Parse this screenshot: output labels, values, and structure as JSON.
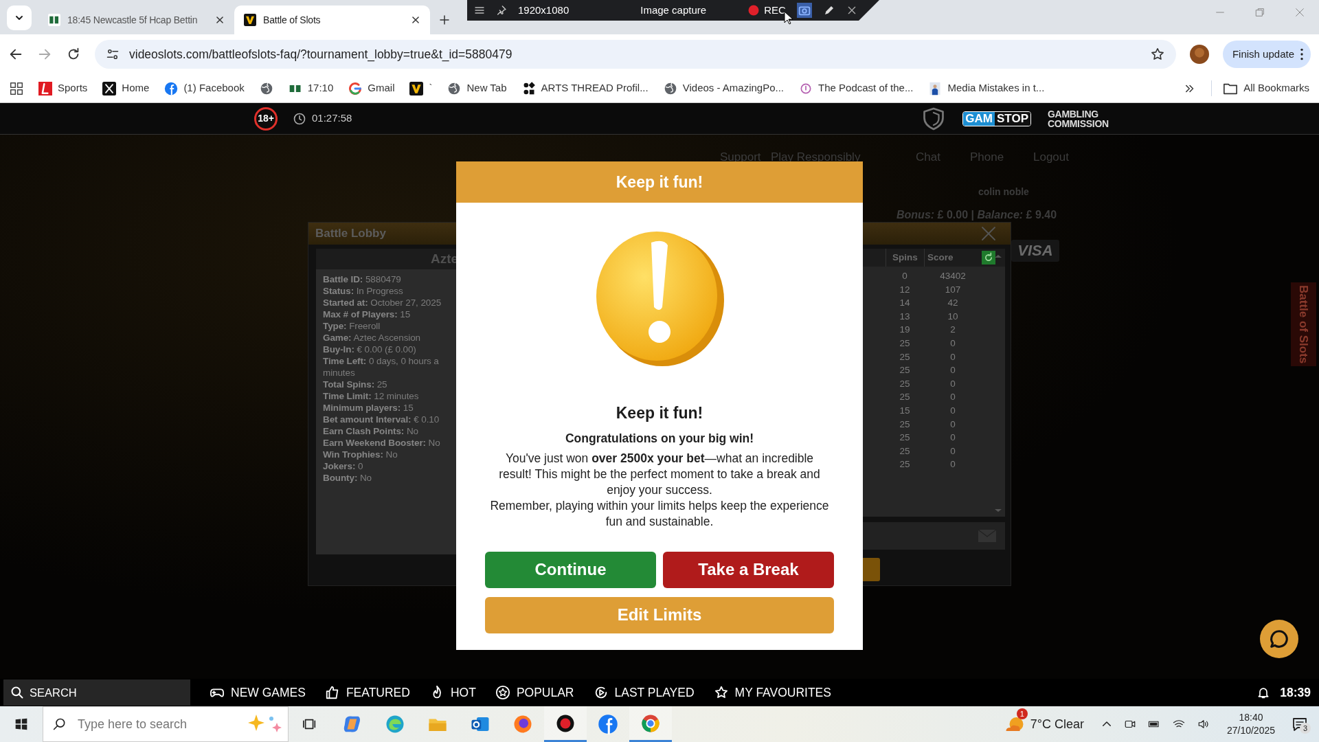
{
  "browser": {
    "tabs": [
      {
        "title": "18:45 Newcastle 5f Hcap Bettin",
        "selected": false
      },
      {
        "title": "Battle of Slots",
        "selected": true
      }
    ],
    "capture_toolbar": {
      "size": "1920x1080",
      "mode": "Image capture",
      "record": "REC"
    },
    "url": "videoslots.com/battleofslots-faq/?tournament_lobby=true&t_id=5880479",
    "update_button": "Finish update",
    "bookmarks": [
      {
        "kind": "ladbrokes",
        "label": "Sports"
      },
      {
        "kind": "x",
        "label": "Home"
      },
      {
        "kind": "facebook",
        "label": "(1) Facebook"
      },
      {
        "kind": "globe"
      },
      {
        "kind": "pp",
        "label": "17:10"
      },
      {
        "kind": "google",
        "label": "Gmail"
      },
      {
        "kind": "v",
        "label": "`"
      },
      {
        "kind": "globe",
        "label": "New Tab"
      },
      {
        "kind": "dots",
        "label": "ARTS THREAD Profil..."
      },
      {
        "kind": "globe",
        "label": "Videos - AmazingPo..."
      },
      {
        "kind": "podcast",
        "label": "The Podcast of the..."
      },
      {
        "kind": "photo",
        "label": "Media Mistakes in t..."
      }
    ],
    "all_bookmarks": "All Bookmarks"
  },
  "site_header": {
    "age_badge": "18+",
    "session_time": "01:27:58",
    "gamstop_left": "GAM",
    "gamstop_right": "STOP",
    "commission": "GAMBLING COMMISSION"
  },
  "page_background": {
    "links": [
      "Support",
      "Play Responsibly",
      "Chat",
      "Phone",
      "Logout"
    ],
    "username": "colin noble",
    "balance": "*Bonus:* £ 0.00 | *Balance:* £ 9.40",
    "card_logo": "VISA",
    "side_tab": "Battle of Slots"
  },
  "battle_lobby": {
    "title": "Battle Lobby",
    "game_header": "Azte",
    "details": [
      {
        "kind": "field",
        "label": "Battle ID:",
        "value": "5880479"
      },
      {
        "kind": "field",
        "label": "Status:",
        "value": "In Progress"
      },
      {
        "kind": "field",
        "label": "Started at:",
        "value": "October 27, 2025"
      },
      {
        "kind": "field",
        "label": "Max # of Players:",
        "value": "15"
      },
      {
        "kind": "field",
        "label": "Type:",
        "value": "Freeroll"
      },
      {
        "kind": "field",
        "label": "Game:",
        "value": "Aztec Ascension"
      },
      {
        "kind": "field",
        "label": "Buy-In:",
        "value": "€ 0.00 (£ 0.00)"
      },
      {
        "kind": "field",
        "label": "Time Left:",
        "value": "0 days, 0 hours a"
      },
      {
        "kind": "wrap",
        "value": "minutes"
      },
      {
        "kind": "field",
        "label": "Total Spins:",
        "value": "25"
      },
      {
        "kind": "field",
        "label": "Time Limit:",
        "value": "12 minutes"
      },
      {
        "kind": "field",
        "label": "Minimum players:",
        "value": "15"
      },
      {
        "kind": "field",
        "label": "Bet amount Interval:",
        "value": "€ 0.10"
      },
      {
        "kind": "field",
        "label": "Earn Clash Points:",
        "value": "No"
      },
      {
        "kind": "field",
        "label": "Earn Weekend Booster:",
        "value": "No"
      },
      {
        "kind": "field",
        "label": "Win Trophies:",
        "value": "No"
      },
      {
        "kind": "field",
        "label": "Jokers:",
        "value": "0"
      },
      {
        "kind": "field",
        "label": "Bounty:",
        "value": "No"
      }
    ],
    "score_columns": [
      "Spins",
      "Score"
    ],
    "scores": [
      {
        "spins": "0",
        "score": "43402"
      },
      {
        "spins": "12",
        "score": "107"
      },
      {
        "spins": "14",
        "score": "42"
      },
      {
        "spins": "13",
        "score": "10"
      },
      {
        "spins": "19",
        "score": "2"
      },
      {
        "spins": "25",
        "score": "0"
      },
      {
        "spins": "25",
        "score": "0"
      },
      {
        "spins": "25",
        "score": "0"
      },
      {
        "spins": "25",
        "score": "0"
      },
      {
        "spins": "25",
        "score": "0"
      },
      {
        "spins": "15",
        "score": "0"
      },
      {
        "spins": "25",
        "score": "0"
      },
      {
        "spins": "25",
        "score": "0"
      },
      {
        "spins": "25",
        "score": "0"
      },
      {
        "spins": "25",
        "score": "0"
      }
    ]
  },
  "modal": {
    "header": "Keep it fun!",
    "heading": "Keep it fun!",
    "congrats": "Congratulations on your big win!",
    "message": "You've just won **over 2500x your bet**—what an incredible result! This might be the perfect moment to take a break and enjoy your success.",
    "reminder": "Remember, playing within your limits helps keep the experience fun and sustainable.",
    "buttons": [
      {
        "kind": "continue",
        "label": "Continue"
      },
      {
        "kind": "break",
        "label": "Take a Break"
      },
      {
        "kind": "limits",
        "label": "Edit Limits"
      }
    ]
  },
  "bottom_nav": {
    "search": "SEARCH",
    "items": [
      {
        "kind": "gamepad",
        "label": "NEW GAMES"
      },
      {
        "kind": "thumb",
        "label": "FEATURED"
      },
      {
        "kind": "flame",
        "label": "HOT"
      },
      {
        "kind": "badge",
        "label": "POPULAR"
      },
      {
        "kind": "replay",
        "label": "LAST PLAYED"
      },
      {
        "kind": "star",
        "label": "MY FAVOURITES"
      }
    ],
    "time": "18:39"
  },
  "taskbar": {
    "search_placeholder": "Type here to search",
    "apps": [
      {
        "kind": "copilot",
        "running": false
      },
      {
        "kind": "edge",
        "running": false
      },
      {
        "kind": "explorer",
        "running": false
      },
      {
        "kind": "outlook",
        "running": false
      },
      {
        "kind": "firefox",
        "running": false
      },
      {
        "kind": "recorder",
        "running": true
      },
      {
        "kind": "facebook",
        "running": false
      },
      {
        "kind": "chrome",
        "running": true
      }
    ],
    "weather_badge": "1",
    "weather": "7°C Clear",
    "time": "18:40",
    "date": "27/10/2025",
    "notifications": "3"
  }
}
